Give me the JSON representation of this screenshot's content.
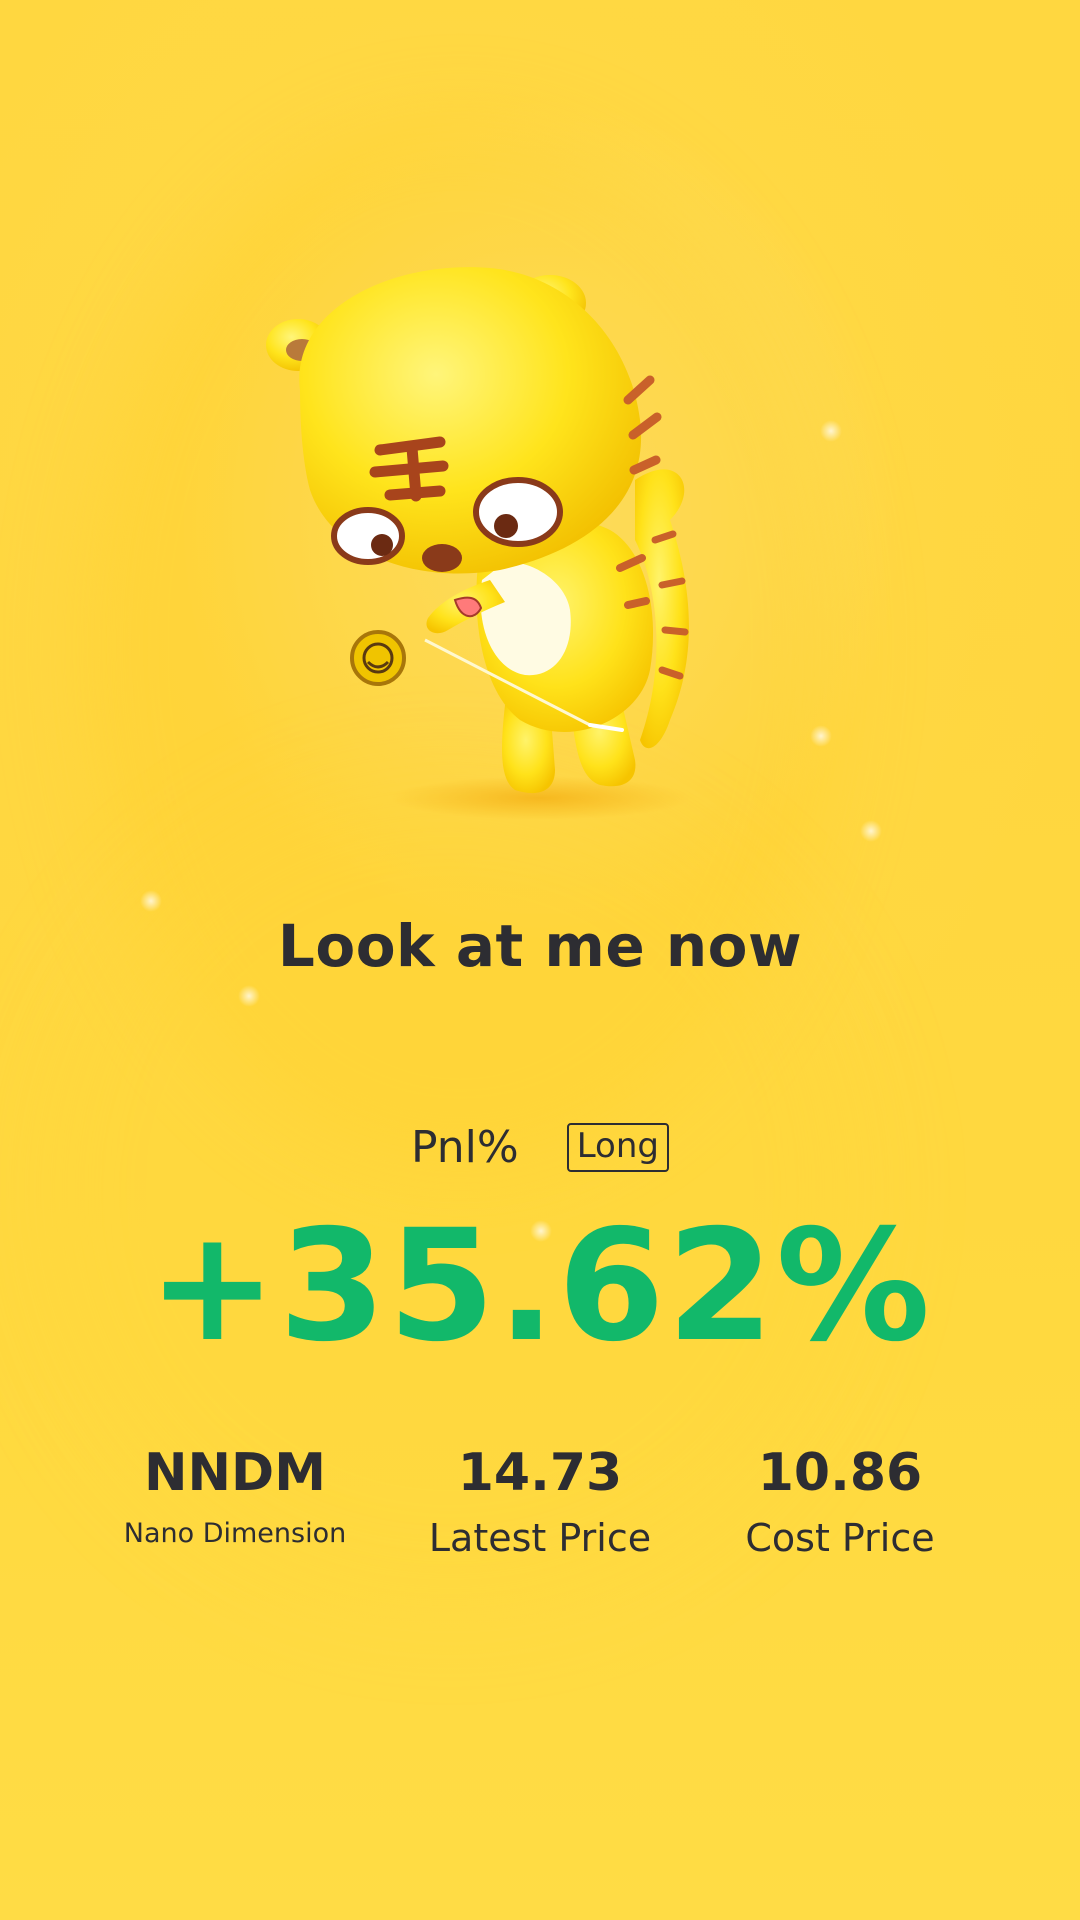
{
  "colors": {
    "background": "#ffd740",
    "text": "#2d2d32",
    "pnl_positive": "#12b86a"
  },
  "mascot": {
    "icon": "tiger-mascot-yoyo-icon"
  },
  "headline": "Look at me now",
  "pnl": {
    "label": "Pnl%",
    "direction": "Long",
    "value": "+35.62%"
  },
  "stats": {
    "symbol": "NNDM",
    "company": "Nano Dimension",
    "latest_price": "14.73",
    "latest_price_label": "Latest Price",
    "cost_price": "10.86",
    "cost_price_label": "Cost Price"
  }
}
